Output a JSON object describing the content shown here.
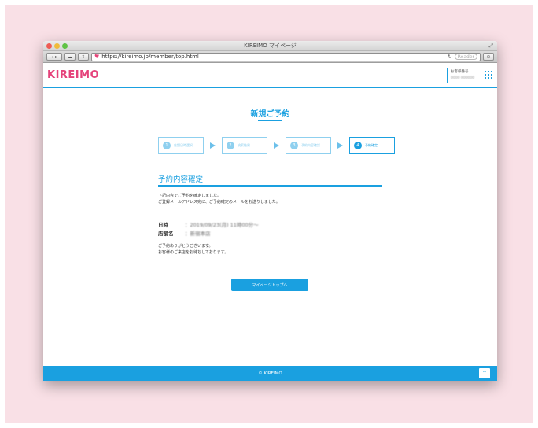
{
  "browser": {
    "window_title": "KIREIMO マイページ",
    "url": "https://kireimo.jp/member/top.html",
    "reader_label": "Reader"
  },
  "site": {
    "logo": "KIREIMO",
    "member_label": "お客様番号",
    "member_number": "0000 000000"
  },
  "page": {
    "title": "新規ご予約",
    "steps": [
      {
        "num": "1",
        "label": "店舗日時選択"
      },
      {
        "num": "2",
        "label": "検索結果"
      },
      {
        "num": "3",
        "label": "予約内容確認"
      },
      {
        "num": "4",
        "label": "予約確定"
      }
    ],
    "active_step": 4,
    "section_title": "予約内容確定",
    "message_line1": "下記内容でご予約を確定しました。",
    "message_line2": "ご登録メールアドレス宛に、ご予約確定のメールをお送りしました。",
    "date_label": "日時",
    "date_value": "：2019/09/23(月) 11時00分～",
    "store_label": "店舗名",
    "store_value": "：新宿本店",
    "thanks_line1": "ご予約ありがとうございます。",
    "thanks_line2": "お客様のご来店をお待ちしております。",
    "cta_label": "マイページトップへ"
  },
  "footer": {
    "copyright": "© KIREIMO",
    "pagetop_icon": "chevron-up-icon"
  },
  "colors": {
    "brand_pink": "#e5437b",
    "brand_blue": "#1aa0e0",
    "background_pink": "#f9e0e6"
  }
}
